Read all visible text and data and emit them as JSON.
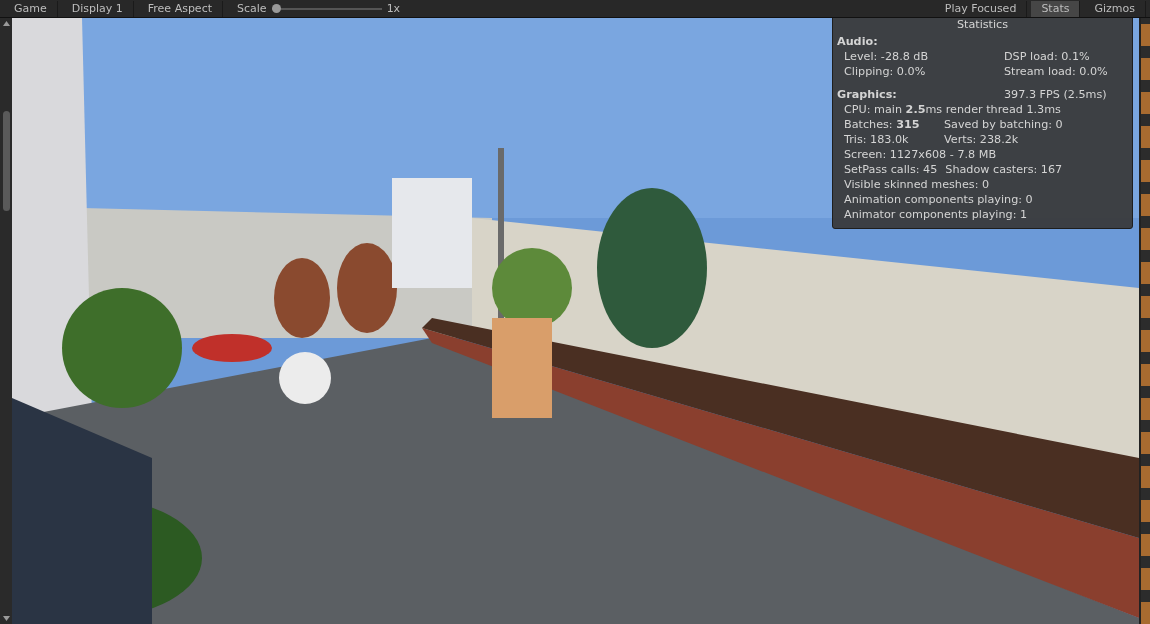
{
  "toolbar": [
    {
      "kind": "tab",
      "label": "Game"
    },
    {
      "kind": "dropdown",
      "label": "Display 1"
    },
    {
      "kind": "dropdown",
      "label": "Free Aspect"
    },
    {
      "kind": "slider",
      "label": "Scale",
      "value": "1x",
      "level": 0
    },
    {
      "kind": "dropdown",
      "label": "Play Focused"
    },
    {
      "kind": "toggle",
      "label": "Stats",
      "selected": true
    },
    {
      "kind": "toggle",
      "label": "Gizmos",
      "selected": false
    }
  ],
  "statistics": {
    "title": "Statistics",
    "sections": [
      {
        "heading": "Audio:",
        "rows": [
          {
            "left": "Level: -28.8 dB",
            "right": "DSP load: 0.1%"
          },
          {
            "left": "Clipping: 0.0%",
            "right": "Stream load: 0.0%"
          }
        ]
      },
      {
        "heading": "Graphics:",
        "heading_value": "397.3 FPS (2.5ms)",
        "rows": [
          {
            "left": "CPU: main **2.5**ms  render thread 1.3ms"
          },
          {
            "left": "Batches: **315**",
            "right": "Saved by batching: 0"
          },
          {
            "left": "Tris: 183.0k",
            "right": "Verts: 238.2k"
          },
          {
            "left": "Screen: 1127x608 - 7.8 MB"
          },
          {
            "left": "SetPass calls: 45",
            "right": "Shadow casters: 167"
          },
          {
            "left": "Visible skinned meshes: 0"
          },
          {
            "left": "Animation components playing: 0"
          },
          {
            "left": "Animator components playing: 1"
          }
        ]
      }
    ]
  }
}
